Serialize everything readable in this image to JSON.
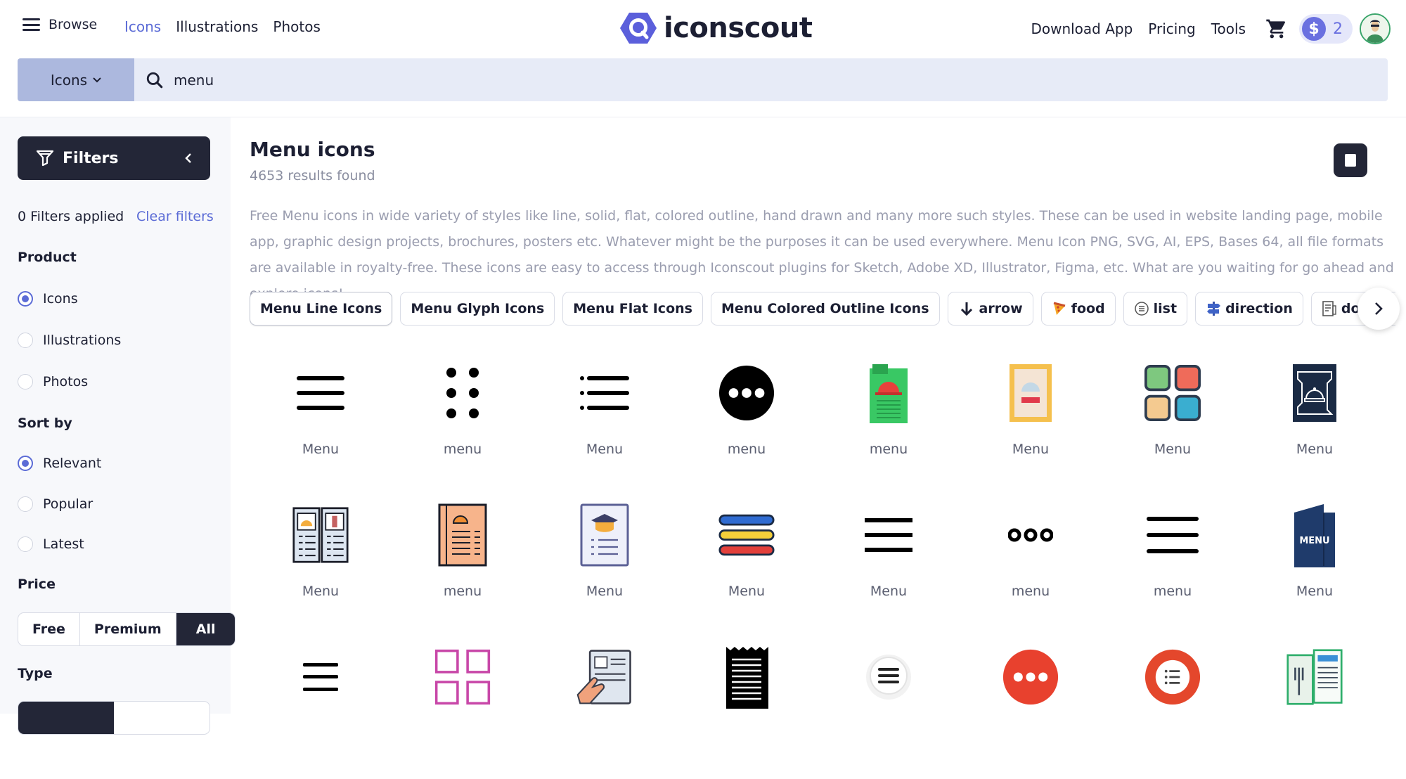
{
  "header": {
    "browse_label": "Browse",
    "nav": [
      "Icons",
      "Illustrations",
      "Photos"
    ],
    "logo_text": "iconscout",
    "right_links": [
      "Download App",
      "Pricing",
      "Tools"
    ],
    "credits": "2",
    "coin_symbol": "$"
  },
  "search": {
    "type_label": "Icons",
    "value": "menu"
  },
  "sidebar": {
    "filters_label": "Filters",
    "filters_applied": "0 Filters applied",
    "clear_filters": "Clear filters",
    "product_heading": "Product",
    "product_options": [
      "Icons",
      "Illustrations",
      "Photos"
    ],
    "product_selected": "Icons",
    "sort_heading": "Sort by",
    "sort_options": [
      "Relevant",
      "Popular",
      "Latest"
    ],
    "sort_selected": "Relevant",
    "price_heading": "Price",
    "price_options": [
      "Free",
      "Premium",
      "All"
    ],
    "price_selected": "All",
    "type_heading": "Type"
  },
  "main": {
    "title": "Menu icons",
    "count": "4653 results found",
    "description": "Free Menu icons in wide variety of styles like line, solid, flat, colored outline, hand drawn and many more such styles. These can be used in website landing page, mobile app, graphic design projects, brochures, posters etc. Whatever might be the purposes it can be used everywhere. Menu Icon PNG, SVG, AI, EPS, Bases 64, all file formats are available in royalty-free. These icons are easy to access through Iconscout plugins for Sketch, Adobe XD, Illustrator, Figma, etc. What are you waiting for go ahead and explore icons!",
    "chips": [
      {
        "label": "Menu Line Icons",
        "icon": ""
      },
      {
        "label": "Menu Glyph Icons",
        "icon": ""
      },
      {
        "label": "Menu Flat Icons",
        "icon": ""
      },
      {
        "label": "Menu Colored Outline Icons",
        "icon": ""
      },
      {
        "label": "arrow",
        "icon": "arrow-down-icon"
      },
      {
        "label": "food",
        "icon": "pizza-icon"
      },
      {
        "label": "list",
        "icon": "list-icon"
      },
      {
        "label": "direction",
        "icon": "signpost-icon"
      },
      {
        "label": "document",
        "icon": "document-icon"
      }
    ],
    "results": [
      {
        "label": "Menu",
        "icon": "hamburger-menu-icon"
      },
      {
        "label": "menu",
        "icon": "six-dots-icon"
      },
      {
        "label": "Menu",
        "icon": "bullet-list-icon"
      },
      {
        "label": "menu",
        "icon": "more-horizontal-circle-icon"
      },
      {
        "label": "menu",
        "icon": "green-menu-card-icon"
      },
      {
        "label": "Menu",
        "icon": "yellow-menu-card-icon"
      },
      {
        "label": "Menu",
        "icon": "app-grid-icon"
      },
      {
        "label": "Menu",
        "icon": "cloche-menu-board-icon"
      },
      {
        "label": "Menu",
        "icon": "open-menu-book-icon"
      },
      {
        "label": "menu",
        "icon": "orange-menu-list-icon"
      },
      {
        "label": "Menu",
        "icon": "graduation-menu-icon"
      },
      {
        "label": "Menu",
        "icon": "colored-bars-icon"
      },
      {
        "label": "Menu",
        "icon": "hamburger-menu-icon"
      },
      {
        "label": "menu",
        "icon": "three-dots-icon"
      },
      {
        "label": "menu",
        "icon": "hamburger-menu-icon"
      },
      {
        "label": "Menu",
        "icon": "menu-book-icon"
      },
      {
        "label": "",
        "icon": "hamburger-menu-icon"
      },
      {
        "label": "",
        "icon": "pink-grid-icon"
      },
      {
        "label": "",
        "icon": "hand-menu-icon"
      },
      {
        "label": "",
        "icon": "receipt-icon"
      },
      {
        "label": "",
        "icon": "menu-button-icon"
      },
      {
        "label": "",
        "icon": "red-dots-icon"
      },
      {
        "label": "",
        "icon": "red-list-icon"
      },
      {
        "label": "",
        "icon": "restaurant-menu-icon"
      }
    ]
  }
}
